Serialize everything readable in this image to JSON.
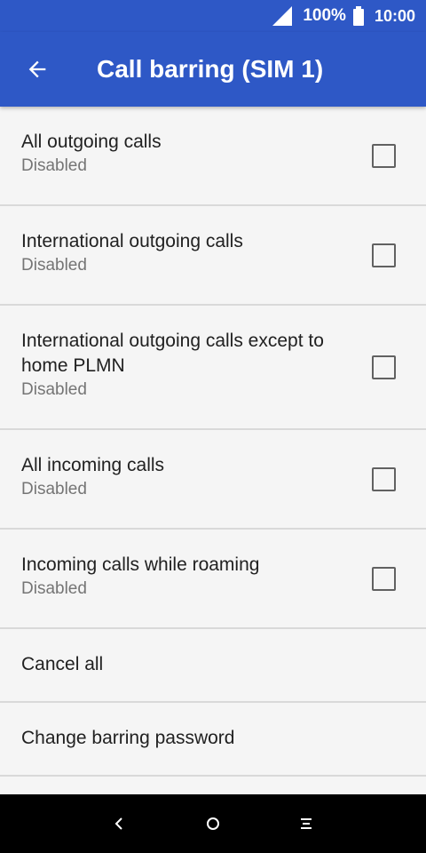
{
  "status_bar": {
    "battery_percent": "100%",
    "time": "10:00",
    "icons": [
      "signal-icon",
      "battery-icon"
    ]
  },
  "app_bar": {
    "title": "Call barring (SIM 1)",
    "back_icon": "arrow-left-icon"
  },
  "items": [
    {
      "title": "All outgoing calls",
      "subtitle": "Disabled",
      "checked": false
    },
    {
      "title": "International outgoing calls",
      "subtitle": "Disabled",
      "checked": false
    },
    {
      "title": "International outgoing calls except to home PLMN",
      "subtitle": "Disabled",
      "checked": false
    },
    {
      "title": "All incoming calls",
      "subtitle": "Disabled",
      "checked": false
    },
    {
      "title": "Incoming calls while roaming",
      "subtitle": "Disabled",
      "checked": false
    }
  ],
  "actions": {
    "cancel_all": "Cancel all",
    "change_password": "Change barring password"
  },
  "nav_bar": {
    "icons": [
      "back-icon",
      "home-icon",
      "menu-icon"
    ]
  },
  "colors": {
    "accent": "#2e58c6",
    "background": "#f5f5f5",
    "divider": "#d9d9d9"
  }
}
